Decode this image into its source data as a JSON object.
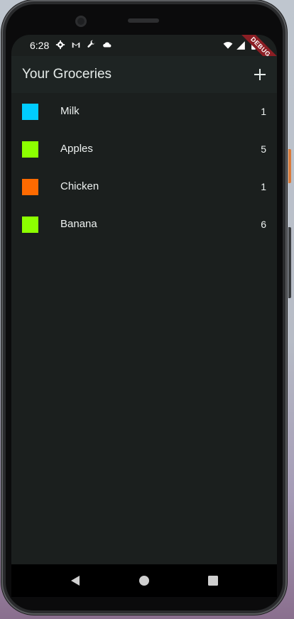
{
  "status_bar": {
    "time": "6:28",
    "left_icons": [
      "gear-icon",
      "gmail-icon",
      "wrench-icon",
      "cloud-icon"
    ],
    "right_icons": [
      "wifi-icon",
      "signal-icon",
      "battery-icon"
    ],
    "debug_banner": "DEBUG"
  },
  "app_bar": {
    "title": "Your Groceries",
    "add_icon": "plus-icon"
  },
  "groceries": [
    {
      "name": "Milk",
      "quantity": "1",
      "color": "#00CCFF"
    },
    {
      "name": "Apples",
      "quantity": "5",
      "color": "#8CFF00"
    },
    {
      "name": "Chicken",
      "quantity": "1",
      "color": "#FF6A00"
    },
    {
      "name": "Banana",
      "quantity": "6",
      "color": "#8CFF00"
    }
  ],
  "nav_bar": {
    "icons": [
      "back-icon",
      "home-icon",
      "recents-icon"
    ]
  },
  "colors": {
    "background": "#1B1F1E",
    "app_bar": "#1E2423",
    "text": "#EEF2F1"
  }
}
